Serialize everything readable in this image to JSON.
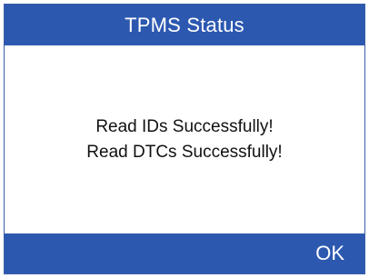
{
  "header": {
    "title": "TPMS Status"
  },
  "message": {
    "lines": [
      "Read IDs Successfully!",
      "Read DTCs Successfully!"
    ]
  },
  "footer": {
    "ok_label": "OK"
  },
  "colors": {
    "bar_background": "#2c58b0",
    "bar_text": "#ffffff",
    "body_background": "#ffffff",
    "body_text": "#111111"
  }
}
